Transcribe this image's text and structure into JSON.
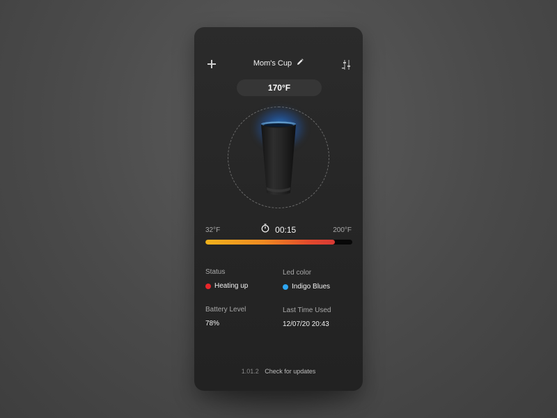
{
  "header": {
    "title": "Mom's Cup",
    "add_icon": "plus-icon",
    "edit_icon": "pencil-icon",
    "settings_icon": "sliders-icon"
  },
  "temperature": {
    "current": "170°F",
    "min_label": "32°F",
    "max_label": "200°F"
  },
  "timer": {
    "icon": "stopwatch-icon",
    "value": "00:15"
  },
  "progress": {
    "fraction": 0.88
  },
  "info": {
    "status": {
      "label": "Status",
      "value": "Heating up",
      "color": "#e8262a"
    },
    "led": {
      "label": "Led color",
      "value": "Indigo Blues",
      "color": "#2ea6f2"
    },
    "battery": {
      "label": "Battery Level",
      "value": "78%"
    },
    "last_used": {
      "label": "Last Time Used",
      "value": "12/07/20 20:43"
    }
  },
  "footer": {
    "version": "1.01.2",
    "update_label": "Check for updates"
  },
  "colors": {
    "accent_glow": "#2896ff",
    "background": "#4a4a4a",
    "card": "#262626"
  }
}
